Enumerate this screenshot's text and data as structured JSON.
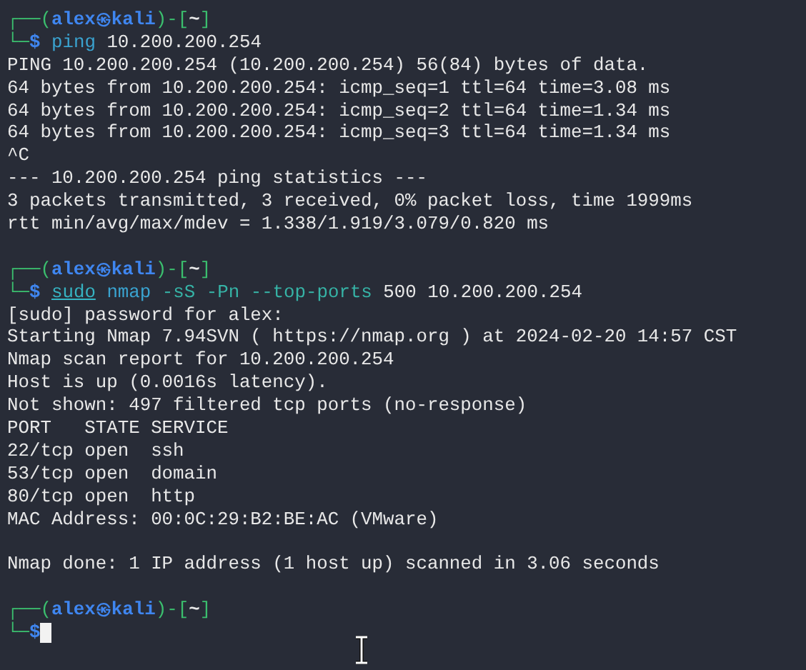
{
  "terminal": {
    "lines": [
      {
        "kind": "prompt",
        "frame_open": "┌──(",
        "user": "alex",
        "at": "㉿",
        "host": "kali",
        "frame_mid": ")-[",
        "dir": "~",
        "frame_close": "]",
        "corner": "└─",
        "sign": "$",
        "cursor": false,
        "command": [
          {
            "kind": "command",
            "text": "ping"
          },
          {
            "kind": "argument",
            "text": "10.200.200.254"
          }
        ]
      },
      {
        "kind": "output",
        "text": "PING 10.200.200.254 (10.200.200.254) 56(84) bytes of data."
      },
      {
        "kind": "output",
        "text": "64 bytes from 10.200.200.254: icmp_seq=1 ttl=64 time=3.08 ms"
      },
      {
        "kind": "output",
        "text": "64 bytes from 10.200.200.254: icmp_seq=2 ttl=64 time=1.34 ms"
      },
      {
        "kind": "output",
        "text": "64 bytes from 10.200.200.254: icmp_seq=3 ttl=64 time=1.34 ms"
      },
      {
        "kind": "output",
        "text": "^C"
      },
      {
        "kind": "output",
        "text": "--- 10.200.200.254 ping statistics ---"
      },
      {
        "kind": "output",
        "text": "3 packets transmitted, 3 received, 0% packet loss, time 1999ms"
      },
      {
        "kind": "output",
        "text": "rtt min/avg/max/mdev = 1.338/1.919/3.079/0.820 ms"
      },
      {
        "kind": "blank"
      },
      {
        "kind": "prompt",
        "frame_open": "┌──(",
        "user": "alex",
        "at": "㉿",
        "host": "kali",
        "frame_mid": ")-[",
        "dir": "~",
        "frame_close": "]",
        "corner": "└─",
        "sign": "$",
        "cursor": false,
        "command": [
          {
            "kind": "precommand",
            "text": "sudo"
          },
          {
            "kind": "command",
            "text": "nmap"
          },
          {
            "kind": "option",
            "text": "-sS"
          },
          {
            "kind": "option",
            "text": "-Pn"
          },
          {
            "kind": "option",
            "text": "--top-ports"
          },
          {
            "kind": "argument",
            "text": "500"
          },
          {
            "kind": "argument",
            "text": "10.200.200.254"
          }
        ]
      },
      {
        "kind": "output",
        "text": "[sudo] password for alex:"
      },
      {
        "kind": "output",
        "text": "Starting Nmap 7.94SVN ( https://nmap.org ) at 2024-02-20 14:57 CST"
      },
      {
        "kind": "output",
        "text": "Nmap scan report for 10.200.200.254"
      },
      {
        "kind": "output",
        "text": "Host is up (0.0016s latency)."
      },
      {
        "kind": "output",
        "text": "Not shown: 497 filtered tcp ports (no-response)"
      },
      {
        "kind": "output",
        "text": "PORT   STATE SERVICE"
      },
      {
        "kind": "output",
        "text": "22/tcp open  ssh"
      },
      {
        "kind": "output",
        "text": "53/tcp open  domain"
      },
      {
        "kind": "output",
        "text": "80/tcp open  http"
      },
      {
        "kind": "output",
        "text": "MAC Address: 00:0C:29:B2:BE:AC (VMware)"
      },
      {
        "kind": "blank"
      },
      {
        "kind": "output",
        "text": "Nmap done: 1 IP address (1 host up) scanned in 3.06 seconds"
      },
      {
        "kind": "blank"
      },
      {
        "kind": "prompt",
        "frame_open": "┌──(",
        "user": "alex",
        "at": "㉿",
        "host": "kali",
        "frame_mid": ")-[",
        "dir": "~",
        "frame_close": "]",
        "corner": "└─",
        "sign": "$",
        "cursor": true
      }
    ]
  }
}
